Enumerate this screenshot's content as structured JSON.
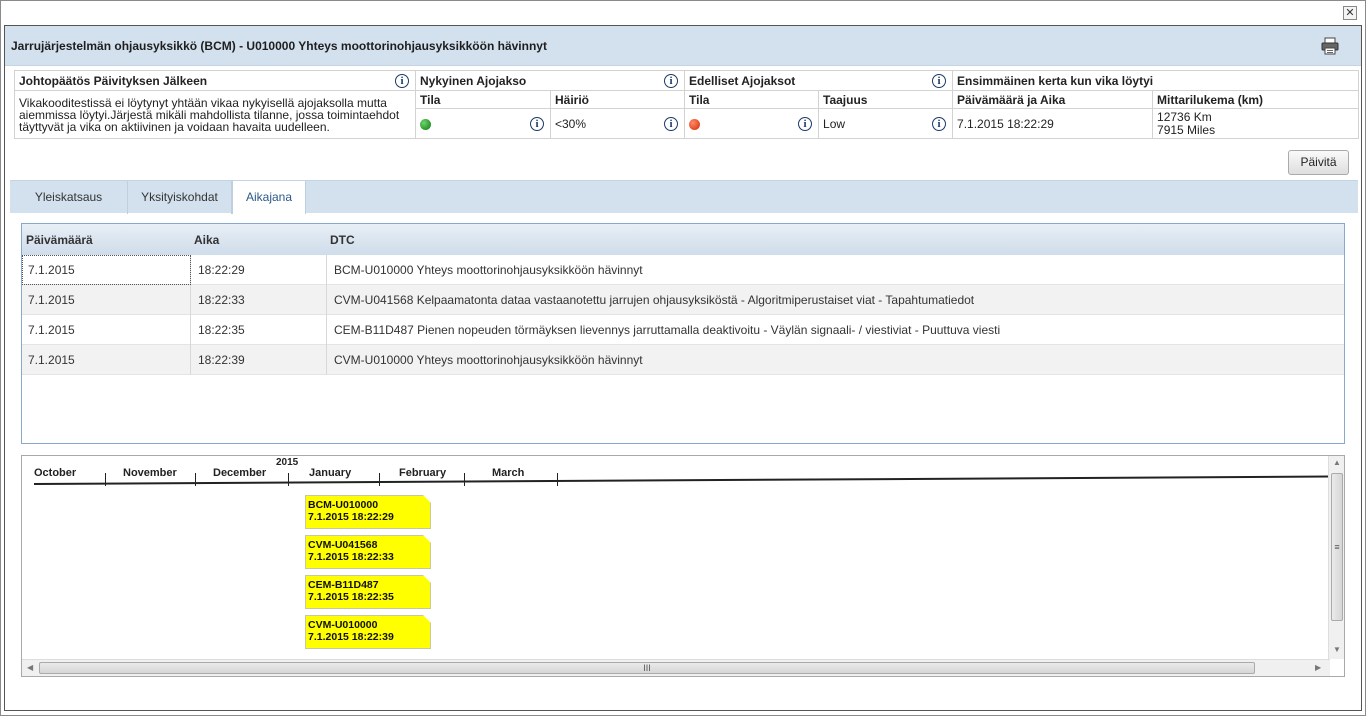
{
  "window": {
    "close_glyph": "✕"
  },
  "dialog": {
    "title": "Jarrujärjestelmän ohjausyksikkö (BCM) - U010000 Yhteys moottorinohjausyksikköön hävinnyt",
    "print_icon": "printer-icon"
  },
  "summary": {
    "conclusion": {
      "header": "Johtopäätös Päivityksen Jälkeen",
      "text": "Vikakooditestissä ei löytynyt yhtään vikaa nykyisellä ajojaksolla mutta aiemmissa löytyi.Järjestä mikäli mahdollista tilanne, jossa toimintaehdot täyttyvät ja vika on aktiivinen ja voidaan havaita uudelleen."
    },
    "current_cycle": {
      "header": "Nykyinen Ajojakso",
      "status_label": "Tila",
      "status_color": "#1a9a1a",
      "disturbance_label": "Häiriö",
      "disturbance_value": "<30%"
    },
    "previous_cycles": {
      "header": "Edelliset Ajojaksot",
      "status_label": "Tila",
      "status_color": "#e83a10",
      "frequency_label": "Taajuus",
      "frequency_value": "Low"
    },
    "first_found": {
      "header": "Ensimmäinen kerta kun vika löytyi",
      "datetime_label": "Päivämäärä ja Aika",
      "datetime_value": "7.1.2015 18:22:29",
      "odometer_label": "Mittarilukema (km)",
      "odometer_km": "12736 Km",
      "odometer_miles": "7915 Miles"
    },
    "info_glyph": "i"
  },
  "update_button": "Päivitä",
  "tabs": [
    {
      "label": "Yleiskatsaus",
      "active": false
    },
    {
      "label": "Yksityiskohdat",
      "active": false
    },
    {
      "label": "Aikajana",
      "active": true
    }
  ],
  "grid": {
    "columns": [
      "Päivämäärä",
      "Aika",
      "DTC"
    ],
    "rows": [
      {
        "date": "7.1.2015",
        "time": "18:22:29",
        "dtc": "BCM-U010000 Yhteys moottorinohjausyksikköön hävinnyt"
      },
      {
        "date": "7.1.2015",
        "time": "18:22:33",
        "dtc": "CVM-U041568 Kelpaamatonta dataa vastaanotettu jarrujen ohjausyksiköstä - Algoritmiperustaiset viat - Tapahtumatiedot"
      },
      {
        "date": "7.1.2015",
        "time": "18:22:35",
        "dtc": "CEM-B11D487 Pienen nopeuden törmäyksen lievennys jarruttamalla deaktivoitu - Väylän signaali- / viestiviat - Puuttuva viesti"
      },
      {
        "date": "7.1.2015",
        "time": "18:22:39",
        "dtc": "CVM-U010000 Yhteys moottorinohjausyksikköön hävinnyt"
      }
    ]
  },
  "timeline": {
    "year": "2015",
    "months": [
      "October",
      "November",
      "December",
      "January",
      "February",
      "March"
    ],
    "events": [
      {
        "code": "BCM-U010000",
        "datetime": "7.1.2015 18:22:29"
      },
      {
        "code": "CVM-U041568",
        "datetime": "7.1.2015 18:22:33"
      },
      {
        "code": "CEM-B11D487",
        "datetime": "7.1.2015 18:22:35"
      },
      {
        "code": "CVM-U010000",
        "datetime": "7.1.2015 18:22:39"
      }
    ],
    "event_color": "#ffff00",
    "scroll_grip": "III"
  },
  "colors": {
    "header_band": "#d3e1ee",
    "grid_border": "#86a9cc"
  }
}
